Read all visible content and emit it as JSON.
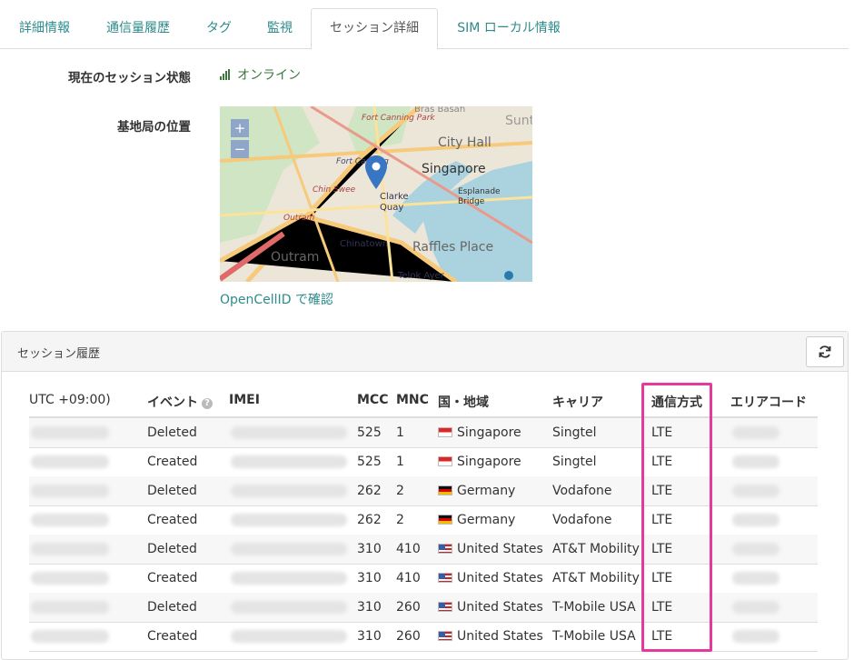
{
  "tabs": [
    {
      "label": "詳細情報"
    },
    {
      "label": "通信量履歴"
    },
    {
      "label": "タグ"
    },
    {
      "label": "監視"
    },
    {
      "label": "セッション詳細"
    },
    {
      "label": "SIM ローカル情報"
    }
  ],
  "session": {
    "status_label": "現在のセッション状態",
    "status_value": "オンライン",
    "location_label": "基地局の位置",
    "opencell_link": "OpenCellID で確認"
  },
  "map": {
    "zoom_in": "+",
    "zoom_out": "−",
    "labels": {
      "singapore": "Singapore",
      "city_hall": "City Hall",
      "raffles": "Raffles Place",
      "chinatown": "Chinatown",
      "outram": "Outram",
      "clarke": "Clarke Quay",
      "esplanade": "Esplanade Bridge",
      "fort": "Fort Canning Park",
      "fort2": "Fort Canning",
      "telok": "Telok Ayer",
      "bras": "Bras Basah",
      "chin": "Chin Swee",
      "suntec": "Sunt"
    }
  },
  "history": {
    "title": "セッション履歴",
    "refresh_icon": "refresh-icon",
    "columns": {
      "time": "UTC +09:00)",
      "event": "イベント",
      "imei": "IMEI",
      "mcc": "MCC",
      "mnc": "MNC",
      "country": "国・地域",
      "carrier": "キャリア",
      "rat": "通信方式",
      "area": "エリアコード"
    },
    "rows": [
      {
        "event": "Deleted",
        "mcc": "525",
        "mnc": "1",
        "flag": "sg",
        "country": "Singapore",
        "carrier": "Singtel",
        "rat": "LTE"
      },
      {
        "event": "Created",
        "mcc": "525",
        "mnc": "1",
        "flag": "sg",
        "country": "Singapore",
        "carrier": "Singtel",
        "rat": "LTE"
      },
      {
        "event": "Deleted",
        "mcc": "262",
        "mnc": "2",
        "flag": "de",
        "country": "Germany",
        "carrier": "Vodafone",
        "rat": "LTE"
      },
      {
        "event": "Created",
        "mcc": "262",
        "mnc": "2",
        "flag": "de",
        "country": "Germany",
        "carrier": "Vodafone",
        "rat": "LTE"
      },
      {
        "event": "Deleted",
        "mcc": "310",
        "mnc": "410",
        "flag": "us",
        "country": "United States",
        "carrier": "AT&T Mobility",
        "rat": "LTE"
      },
      {
        "event": "Created",
        "mcc": "310",
        "mnc": "410",
        "flag": "us",
        "country": "United States",
        "carrier": "AT&T Mobility",
        "rat": "LTE"
      },
      {
        "event": "Deleted",
        "mcc": "310",
        "mnc": "260",
        "flag": "us",
        "country": "United States",
        "carrier": "T-Mobile USA",
        "rat": "LTE"
      },
      {
        "event": "Created",
        "mcc": "310",
        "mnc": "260",
        "flag": "us",
        "country": "United States",
        "carrier": "T-Mobile USA",
        "rat": "LTE"
      }
    ]
  },
  "colors": {
    "accent": "#2e8b8b",
    "online": "#3c763d",
    "highlight": "#e6399b"
  }
}
